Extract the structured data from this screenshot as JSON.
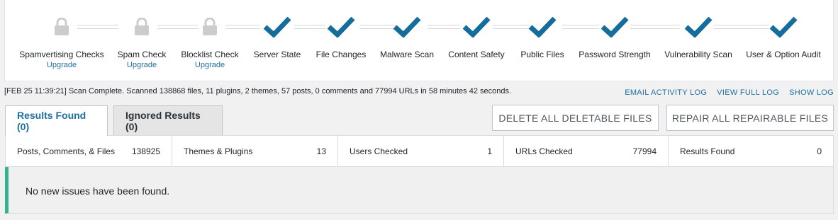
{
  "stages": [
    {
      "label": "Spamvertising Checks",
      "upgrade": "Upgrade",
      "status": "locked"
    },
    {
      "label": "Spam Check",
      "upgrade": "Upgrade",
      "status": "locked"
    },
    {
      "label": "Blocklist Check",
      "upgrade": "Upgrade",
      "status": "locked"
    },
    {
      "label": "Server State",
      "status": "complete"
    },
    {
      "label": "File Changes",
      "status": "complete"
    },
    {
      "label": "Malware Scan",
      "status": "complete"
    },
    {
      "label": "Content Safety",
      "status": "complete"
    },
    {
      "label": "Public Files",
      "status": "complete"
    },
    {
      "label": "Password Strength",
      "status": "complete"
    },
    {
      "label": "Vulnerability Scan",
      "status": "complete"
    },
    {
      "label": "User & Option Audit",
      "status": "complete"
    }
  ],
  "status_text": "[FEB 25 11:39:21] Scan Complete. Scanned 138868 files, 11 plugins, 2 themes, 57 posts, 0 comments and 77994 URLs in 58 minutes 42 seconds.",
  "log_links": {
    "email_activity": "EMAIL ACTIVITY LOG",
    "view_full": "VIEW FULL LOG",
    "show": "SHOW LOG"
  },
  "tabs": {
    "results_found": "Results Found (0)",
    "ignored_results": "Ignored Results (0)"
  },
  "actions": {
    "delete_all": "DELETE ALL DELETABLE FILES",
    "repair_all": "REPAIR ALL REPAIRABLE FILES"
  },
  "summary": [
    {
      "label": "Posts, Comments, & Files",
      "value": "138925"
    },
    {
      "label": "Themes & Plugins",
      "value": "13"
    },
    {
      "label": "Users Checked",
      "value": "1"
    },
    {
      "label": "URLs Checked",
      "value": "77994"
    },
    {
      "label": "Results Found",
      "value": "0"
    }
  ],
  "result_message": "No new issues have been found.",
  "colors": {
    "accent": "#1f6fa3",
    "check": "#156d9c",
    "lock": "#cccccc",
    "success_bar": "#35b28f"
  }
}
